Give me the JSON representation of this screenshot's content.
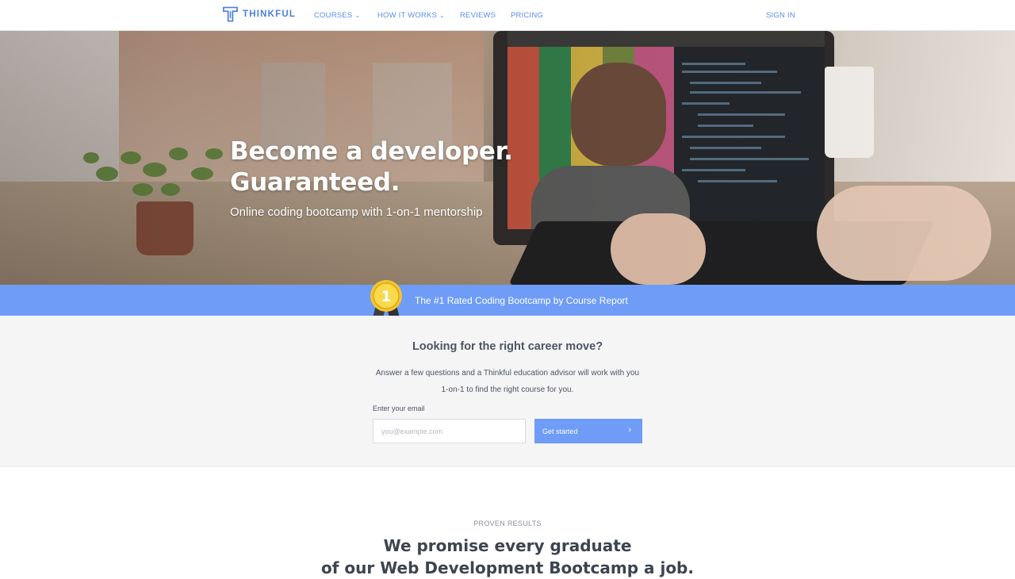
{
  "nav": {
    "logo_text": "THINKFUL",
    "links": [
      {
        "label": "COURSES",
        "has_dropdown": true
      },
      {
        "label": "HOW IT WORKS",
        "has_dropdown": true
      },
      {
        "label": "REVIEWS",
        "has_dropdown": false
      },
      {
        "label": "PRICING",
        "has_dropdown": false
      }
    ],
    "sign_in": "SIGN IN"
  },
  "hero": {
    "headline_line1": "Become a developer.",
    "headline_line2": "Guaranteed.",
    "subhead": "Online coding bootcamp with 1-on-1 mentorship"
  },
  "banner": {
    "text": "The #1 Rated Coding Bootcamp by Course Report",
    "medal_number": "1",
    "icon": "medal-icon"
  },
  "lead_form": {
    "title": "Looking for the right career move?",
    "description": "Answer a few questions and a Thinkful education advisor will work with you 1-on-1 to find the right course for you.",
    "email_label": "Enter your email",
    "email_placeholder": "you@example.com",
    "email_value": "",
    "button_label": "Get started",
    "button_icon": "chevron-right-icon"
  },
  "results": {
    "eyebrow": "PROVEN RESULTS",
    "title_line1": "We promise every graduate",
    "title_line2": "of our Web Development Bootcamp a job."
  },
  "colors": {
    "brand_blue": "#6e9cf7",
    "nav_link": "#5b8ee6",
    "text_dark": "#4d5462",
    "form_bg": "#f5f5f6"
  }
}
